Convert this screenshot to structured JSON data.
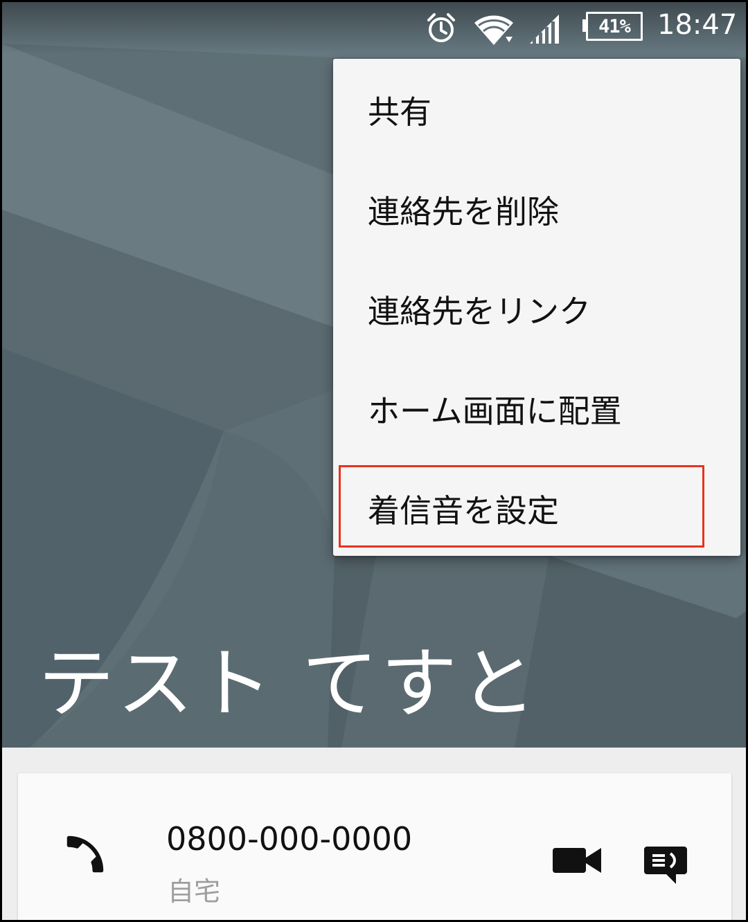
{
  "status_bar": {
    "battery_percent": "41%",
    "time": "18:47",
    "icons": [
      "alarm-icon",
      "wifi-icon",
      "cellular-signal-icon",
      "battery-icon"
    ]
  },
  "contact": {
    "name": "テスト てすと"
  },
  "overflow_menu": {
    "items": [
      {
        "label": "共有"
      },
      {
        "label": "連絡先を削除"
      },
      {
        "label": "連絡先をリンク"
      },
      {
        "label": "ホーム画面に配置"
      },
      {
        "label": "着信音を設定"
      }
    ],
    "highlighted_item": "着信音を設定",
    "highlight_color": "#e8311d"
  },
  "phone_entry": {
    "number": "0800-000-0000",
    "type": "自宅",
    "actions": [
      "video-call-icon",
      "message-icon"
    ]
  },
  "colors": {
    "header_background": "#5d6d73",
    "menu_background": "#f5f5f5",
    "card_background": "#fafafa"
  }
}
